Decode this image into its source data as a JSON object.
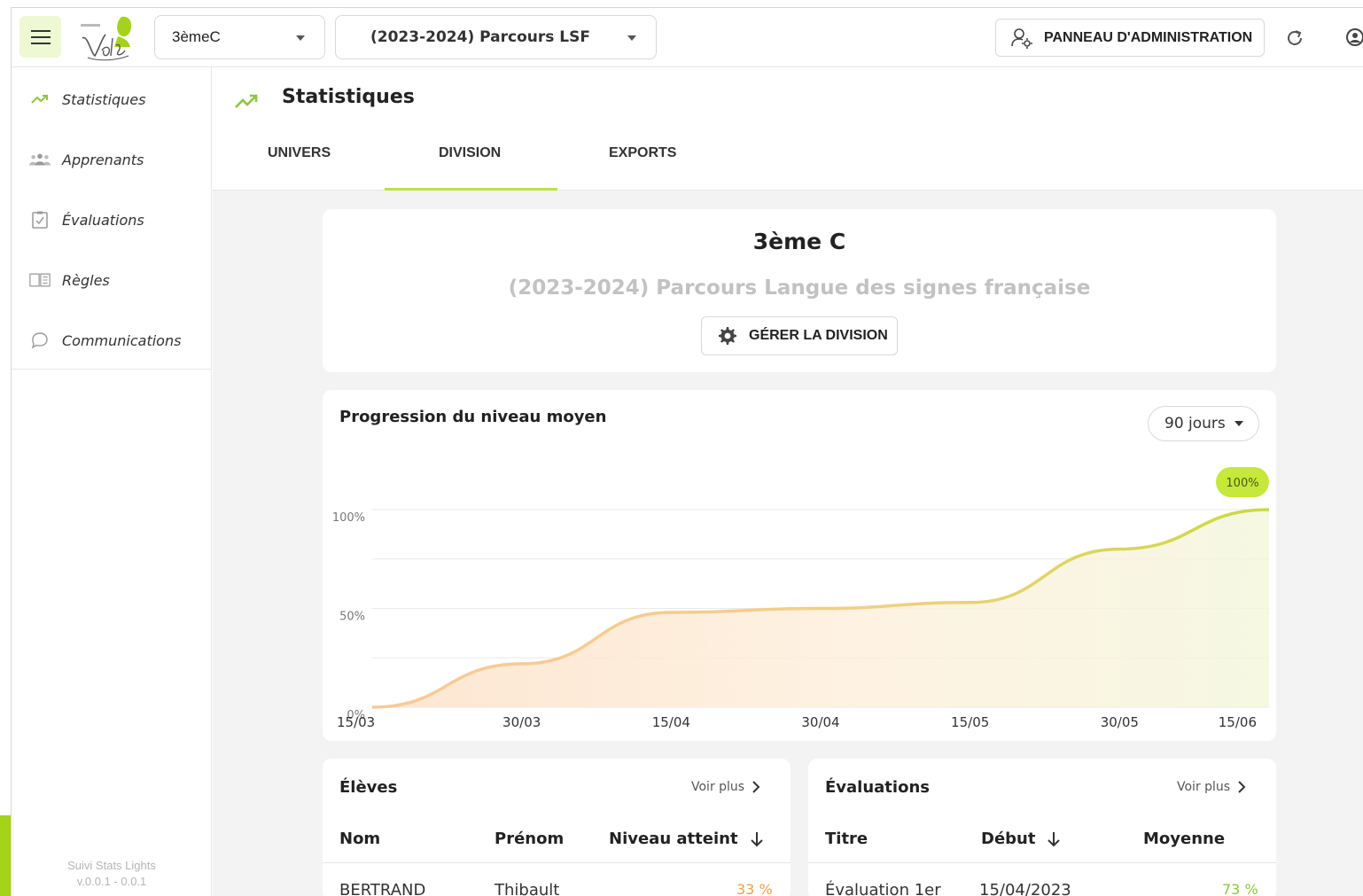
{
  "topbar": {
    "class_select": "3èmeC",
    "parcours_select": "(2023-2024) Parcours LSF",
    "admin_button": "PANNEAU D'ADMINISTRATION"
  },
  "sidebar": {
    "items": [
      {
        "label": "Statistiques",
        "icon": "trending-up-icon"
      },
      {
        "label": "Apprenants",
        "icon": "users-icon"
      },
      {
        "label": "Évaluations",
        "icon": "clipboard-check-icon"
      },
      {
        "label": "Règles",
        "icon": "book-icon"
      },
      {
        "label": "Communications",
        "icon": "chat-icon"
      }
    ],
    "version_line1": "Suivi Stats Lights",
    "version_line2": "v.0.0.1 - 0.0.1"
  },
  "main": {
    "title": "Statistiques",
    "tabs": [
      "UNIVERS",
      "DIVISION",
      "EXPORTS"
    ],
    "active_tab": "DIVISION"
  },
  "division": {
    "name": "3ème C",
    "parcours": "(2023-2024) Parcours Langue des signes française",
    "manage_button": "GÉRER LA DIVISION"
  },
  "progression": {
    "title": "Progression du niveau moyen",
    "period": "90 jours",
    "badge": "100%"
  },
  "chart_data": {
    "type": "area",
    "title": "Progression du niveau moyen",
    "x": [
      "15/03",
      "30/03",
      "15/04",
      "30/04",
      "15/05",
      "30/05",
      "15/06"
    ],
    "values": [
      0,
      22,
      48,
      50,
      53,
      80,
      100
    ],
    "ytick_labels": [
      "0%",
      "50%",
      "100%"
    ],
    "ylim": [
      0,
      100
    ],
    "colors": {
      "start": "#f8c99a",
      "end": "#c9db3c"
    },
    "grid": true
  },
  "students": {
    "title": "Élèves",
    "more": "Voir plus",
    "headers": [
      "Nom",
      "Prénom",
      "Niveau atteint"
    ],
    "rows": [
      [
        "BERTRAND",
        "Thibault",
        "33 %"
      ]
    ]
  },
  "evaluations": {
    "title": "Évaluations",
    "more": "Voir plus",
    "headers": [
      "Titre",
      "Début",
      "Moyenne"
    ],
    "rows": [
      [
        "Évaluation 1er",
        "15/04/2023",
        "73 %"
      ]
    ]
  },
  "colors": {
    "accent": "#a5d21a",
    "warn": "#f0a04b",
    "good": "#8cc63f"
  }
}
